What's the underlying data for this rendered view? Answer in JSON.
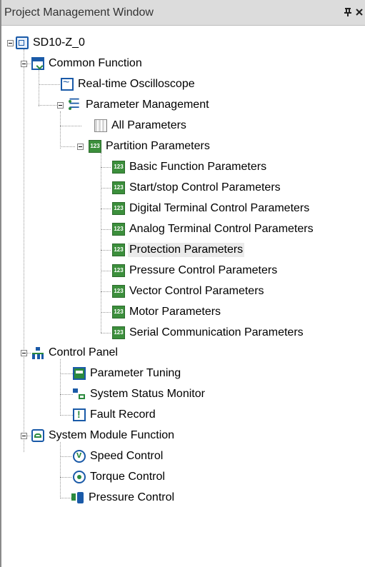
{
  "window": {
    "title": "Project Management Window",
    "pin_glyph": "⍑",
    "close_glyph": "✕"
  },
  "tree": {
    "root": {
      "label": "SD10-Z_0",
      "icon": "device-icon"
    },
    "common_function": {
      "label": "Common Function",
      "icon": "window-icon"
    },
    "realtime_oscilloscope": {
      "label": "Real-time Oscilloscope",
      "icon": "oscilloscope-icon"
    },
    "parameter_management": {
      "label": "Parameter Management",
      "icon": "list-icon"
    },
    "all_parameters": {
      "label": "All Parameters",
      "icon": "grid-icon"
    },
    "partition_parameters": {
      "label": "Partition Parameters",
      "icon": "number-icon"
    },
    "partitions": [
      {
        "label": "Basic Function Parameters"
      },
      {
        "label": "Start/stop Control Parameters"
      },
      {
        "label": "Digital Terminal Control Parameters"
      },
      {
        "label": "Analog Terminal Control Parameters"
      },
      {
        "label": "Protection Parameters"
      },
      {
        "label": "Pressure Control Parameters"
      },
      {
        "label": "Vector Control Parameters"
      },
      {
        "label": "Motor Parameters"
      },
      {
        "label": "Serial Communication Parameters"
      }
    ],
    "selected_partition": "Protection Parameters",
    "control_panel": {
      "label": "Control Panel",
      "icon": "org-chart-icon"
    },
    "parameter_tuning": {
      "label": "Parameter Tuning",
      "icon": "tuning-icon"
    },
    "system_status_monitor": {
      "label": "System Status Monitor",
      "icon": "monitor-icon"
    },
    "fault_record": {
      "label": "Fault Record",
      "icon": "fault-icon"
    },
    "system_module_function": {
      "label": "System Module Function",
      "icon": "module-icon"
    },
    "speed_control": {
      "label": "Speed Control",
      "icon": "speed-icon"
    },
    "torque_control": {
      "label": "Torque Control",
      "icon": "torque-icon"
    },
    "pressure_control": {
      "label": "Pressure Control",
      "icon": "pressure-icon"
    }
  },
  "colors": {
    "accent_blue": "#1a5aa8",
    "accent_green": "#2b8a3e",
    "title_bar": "#dcdcdc"
  }
}
